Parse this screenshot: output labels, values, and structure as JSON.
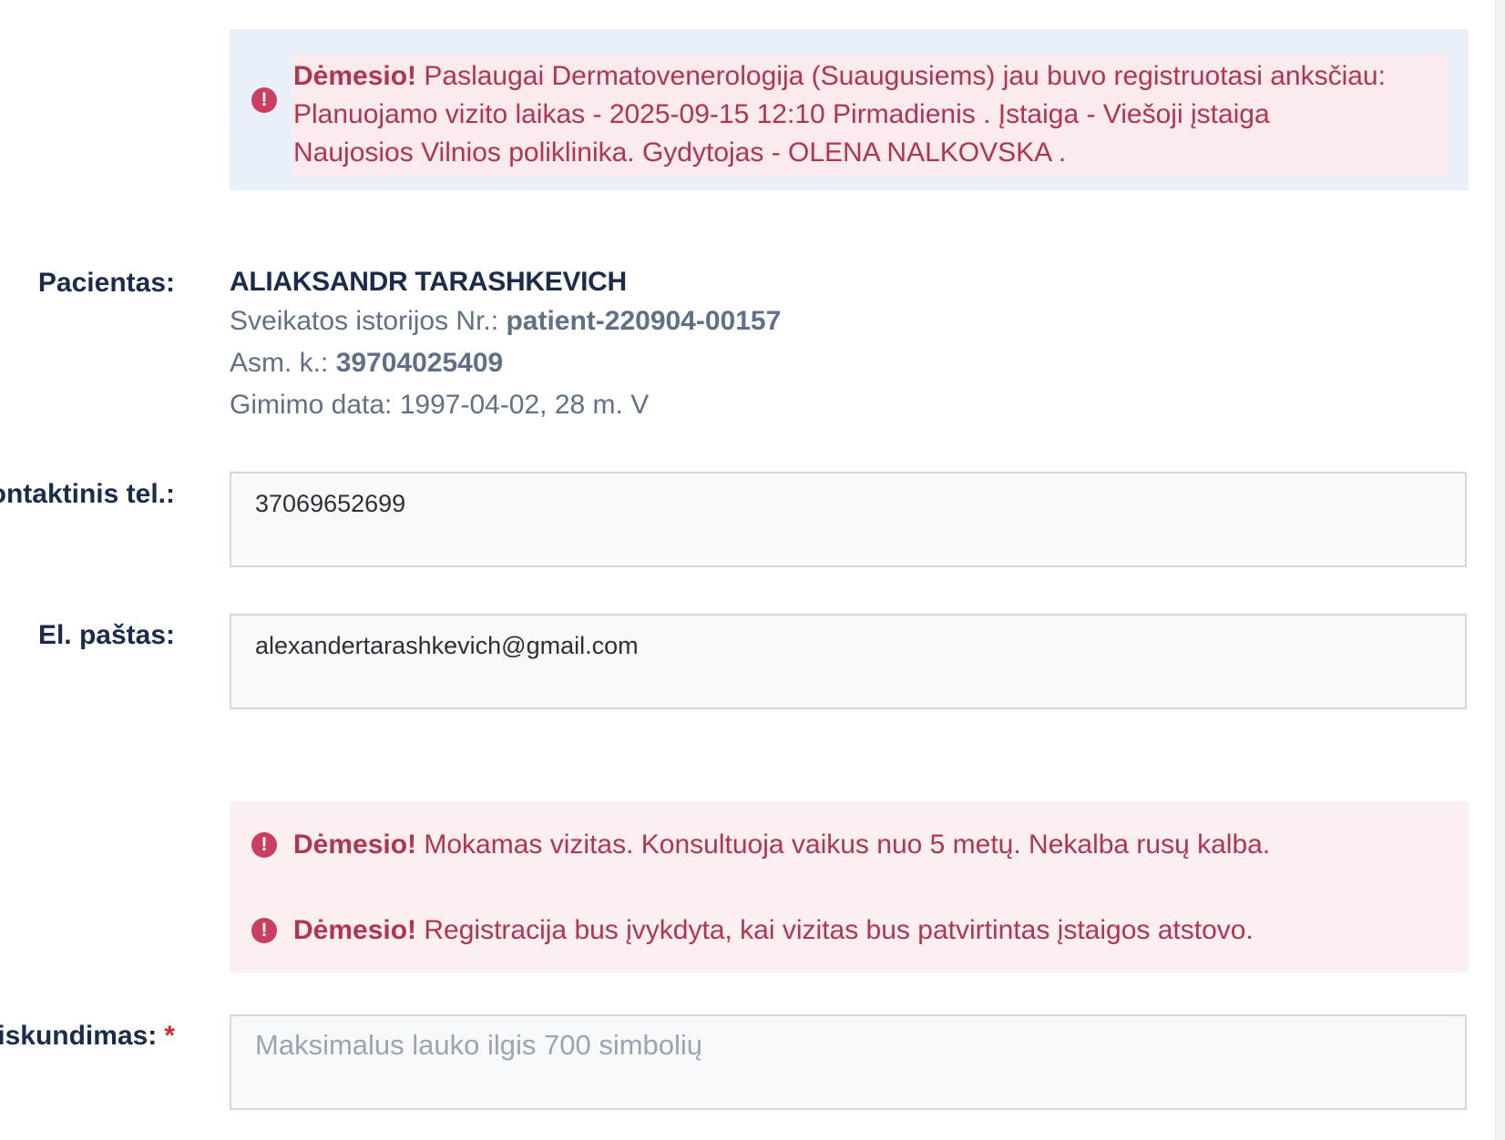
{
  "previous_registration_alert": {
    "prefix": "Dėmesio!",
    "lines": [
      " Paslaugai Dermatovenerologija (Suaugusiems) jau buvo registruotasi anksčiau:",
      "Planuojamo vizito laikas - 2025-09-15 12:10 Pirmadienis . Įstaiga - Viešoji įstaiga",
      "Naujosios Vilnios poliklinika. Gydytojas - OLENA NALKOVSKA ."
    ]
  },
  "patient": {
    "label": "Pacientas:",
    "name": "ALIAKSANDR TARASHKEVICH",
    "history_label": "Sveikatos istorijos Nr.: ",
    "history_number": "patient-220904-00157",
    "personal_code_label": "Asm. k.: ",
    "personal_code": "39704025409",
    "birth_label": "Gimimo data: 1997-04-02,  28 m. V"
  },
  "phone": {
    "label": "ontaktinis tel.:",
    "value": "37069652699"
  },
  "email": {
    "label": "El. paštas:",
    "value": "alexandertarashkevich@gmail.com"
  },
  "notice_alert": {
    "items": [
      {
        "prefix": "Dėmesio!",
        "text": " Mokamas vizitas. Konsultuoja vaikus nuo 5 metų. Nekalba rusų kalba."
      },
      {
        "prefix": "Dėmesio!",
        "text": " Registracija bus įvykdyta, kai vizitas bus patvirtintas įstaigos atstovo."
      }
    ]
  },
  "complaint": {
    "label": "iskundimas:",
    "required_mark": "*",
    "placeholder": "Maksimalus lauko ilgis 700 simbolių"
  },
  "icons": {
    "warning": "exclamation-circle-icon",
    "warning_glyph": "!"
  },
  "colors": {
    "alert_text": "#b2344f",
    "alert_icon": "#cc3e5f",
    "info_background": "#e9f0fa",
    "danger_background": "#fbeff2",
    "label_text": "#1b2b4b",
    "secondary_text": "#607089",
    "required": "#d12a2a"
  }
}
